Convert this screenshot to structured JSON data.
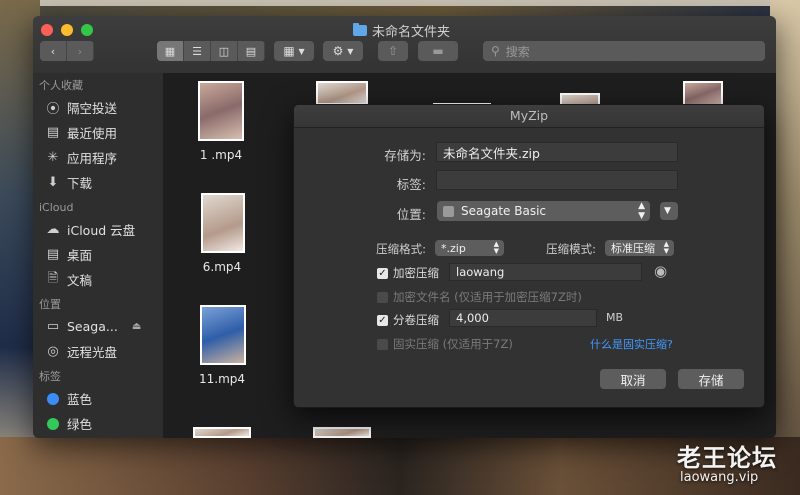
{
  "window": {
    "title": "未命名文件夹",
    "search_placeholder": "搜索"
  },
  "sidebar": {
    "favorites_header": "个人收藏",
    "favorites": [
      {
        "label": "隔空投送",
        "icon": "airdrop-icon"
      },
      {
        "label": "最近使用",
        "icon": "recents-icon"
      },
      {
        "label": "应用程序",
        "icon": "applications-icon"
      },
      {
        "label": "下载",
        "icon": "downloads-icon"
      }
    ],
    "icloud_header": "iCloud",
    "icloud": [
      {
        "label": "iCloud 云盘",
        "icon": "cloud-icon"
      },
      {
        "label": "桌面",
        "icon": "desktop-icon"
      },
      {
        "label": "文稿",
        "icon": "document-icon"
      }
    ],
    "locations_header": "位置",
    "locations": [
      {
        "label": "Seaga...",
        "icon": "drive-icon"
      },
      {
        "label": "远程光盘",
        "icon": "disc-icon"
      }
    ],
    "tags_header": "标签",
    "tags": [
      {
        "label": "蓝色",
        "color": "#3b8cf5"
      },
      {
        "label": "绿色",
        "color": "#34c759"
      }
    ]
  },
  "files": [
    {
      "name": "1 .mp4"
    },
    {
      "name": "6.mp4"
    },
    {
      "name": "11.mp4"
    }
  ],
  "dialog": {
    "title": "MyZip",
    "save_as_label": "存储为:",
    "save_as_value": "未命名文件夹.zip",
    "tags_label": "标签:",
    "location_label": "位置:",
    "location_value": "Seagate Basic",
    "format_label": "压缩格式:",
    "format_value": "*.zip",
    "mode_label": "压缩模式:",
    "mode_value": "标准压缩",
    "encrypt_label": "加密压缩",
    "encrypt_password": "laowang",
    "encrypt_names_label": "加密文件名 (仅适用于加密压缩7Z时)",
    "split_label": "分卷压缩",
    "split_value": "4,000",
    "split_unit": "MB",
    "solid_label": "固实压缩 (仅适用于7Z)",
    "solid_link": "什么是固实压缩?",
    "cancel": "取消",
    "save": "存储"
  },
  "watermark": {
    "title": "老王论坛",
    "url": "laowang.vip"
  },
  "colors": {
    "accent": "#3f9bff",
    "close": "#fc5f57",
    "minimize": "#fdbc2e",
    "maximize": "#33c748"
  }
}
